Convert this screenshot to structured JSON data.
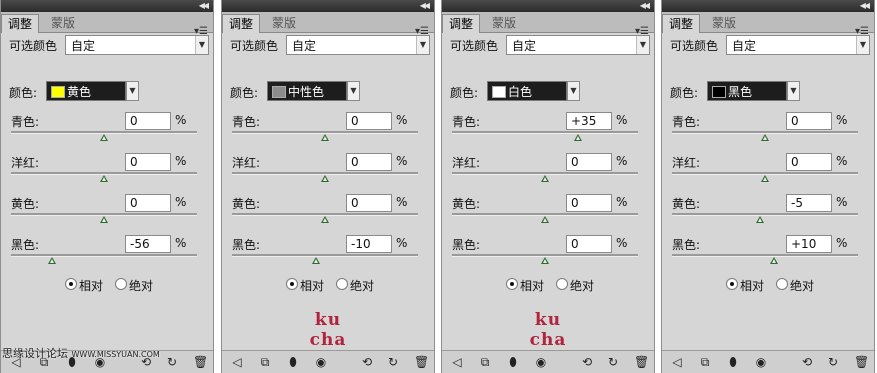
{
  "panels": [
    {
      "tabs": [
        "调整",
        "蒙版"
      ],
      "preset_label": "可选颜色",
      "preset_value": "自定",
      "color_label": "颜色:",
      "color_name": "黄色",
      "swatch_color": "#ffff00",
      "sliders": [
        {
          "label": "青色:",
          "value": "0",
          "unit": "%",
          "level": 0
        },
        {
          "label": "洋红:",
          "value": "0",
          "unit": "%",
          "level": 0
        },
        {
          "label": "黄色:",
          "value": "0",
          "unit": "%",
          "level": 0
        },
        {
          "label": "黑色:",
          "value": "-56",
          "unit": "%",
          "level": -56
        }
      ],
      "method_options": [
        "相对",
        "绝对"
      ],
      "method_selected": 0,
      "brand_text": ""
    },
    {
      "tabs": [
        "调整",
        "蒙版"
      ],
      "preset_label": "可选颜色",
      "preset_value": "自定",
      "color_label": "颜色:",
      "color_name": "中性色",
      "swatch_color": "#8c8c8c",
      "sliders": [
        {
          "label": "青色:",
          "value": "0",
          "unit": "%",
          "level": 0
        },
        {
          "label": "洋红:",
          "value": "0",
          "unit": "%",
          "level": 0
        },
        {
          "label": "黄色:",
          "value": "0",
          "unit": "%",
          "level": 0
        },
        {
          "label": "黑色:",
          "value": "-10",
          "unit": "%",
          "level": -10
        }
      ],
      "method_options": [
        "相对",
        "绝对"
      ],
      "method_selected": 0,
      "brand_text": "ku cha"
    },
    {
      "tabs": [
        "调整",
        "蒙版"
      ],
      "preset_label": "可选颜色",
      "preset_value": "自定",
      "color_label": "颜色:",
      "color_name": "白色",
      "swatch_color": "#ffffff",
      "sliders": [
        {
          "label": "青色:",
          "value": "+35",
          "unit": "%",
          "level": 35
        },
        {
          "label": "洋红:",
          "value": "0",
          "unit": "%",
          "level": 0
        },
        {
          "label": "黄色:",
          "value": "0",
          "unit": "%",
          "level": 0
        },
        {
          "label": "黑色:",
          "value": "0",
          "unit": "%",
          "level": 0
        }
      ],
      "method_options": [
        "相对",
        "绝对"
      ],
      "method_selected": 0,
      "brand_text": "ku cha"
    },
    {
      "tabs": [
        "调整",
        "蒙版"
      ],
      "preset_label": "可选颜色",
      "preset_value": "自定",
      "color_label": "颜色:",
      "color_name": "黑色",
      "swatch_color": "#000000",
      "sliders": [
        {
          "label": "青色:",
          "value": "0",
          "unit": "%",
          "level": 0
        },
        {
          "label": "洋红:",
          "value": "0",
          "unit": "%",
          "level": 0
        },
        {
          "label": "黄色:",
          "value": "-5",
          "unit": "%",
          "level": -5
        },
        {
          "label": "黑色:",
          "value": "+10",
          "unit": "%",
          "level": 10
        }
      ],
      "method_options": [
        "相对",
        "绝对"
      ],
      "method_selected": 0,
      "brand_text": ""
    }
  ],
  "bottom_icons": [
    "back-arrow-icon",
    "clip-to-layer-icon",
    "visibility-eye-icon",
    "view-previous-icon",
    "reset-icon",
    "trash-icon"
  ],
  "watermark": {
    "text": "思缘设计论坛",
    "url": "WWW.MISSYUAN.COM"
  },
  "colors": {
    "thumb": "#2f6a2f",
    "brand": "#b0243d",
    "panel_bg": "#d6d6d6"
  }
}
